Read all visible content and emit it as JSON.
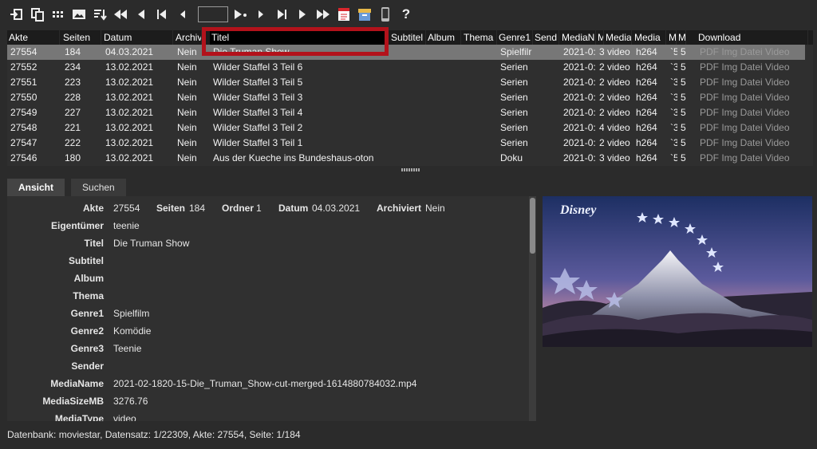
{
  "toolbar": {
    "icons": [
      "import-icon",
      "copy-icon",
      "grid-icon",
      "image-icon",
      "sort-icon",
      "first-page-icon",
      "prev-page-icon",
      "first-record-icon",
      "prev-record-icon",
      "record-input",
      "play-icon",
      "next-record-icon",
      "last-record-icon",
      "next-page-icon",
      "last-page-icon",
      "pdf-icon",
      "archive-icon",
      "phone-icon",
      "help-icon"
    ],
    "record_value": "",
    "help_label": "?"
  },
  "table": {
    "columns": [
      "Akte",
      "Seiten",
      "Datum",
      "Archiv",
      "Titel",
      "Subtitel",
      "Album",
      "Thema",
      "Genre1",
      "Send",
      "MediaN",
      "M",
      "Media",
      "Media",
      "M",
      "M",
      "Download"
    ],
    "rows": [
      {
        "akte": "27554",
        "seiten": "184",
        "datum": "04.03.2021",
        "archiv": "Nein",
        "titel": "Die Truman Show",
        "genre": "Spielfilr",
        "median": "2021-0:",
        "m": "3",
        "mtype": "video",
        "codec": "h264",
        "m1": "`5",
        "m2": "5",
        "download": "PDF Img Datei Video"
      },
      {
        "akte": "27552",
        "seiten": "234",
        "datum": "13.02.2021",
        "archiv": "Nein",
        "titel": "Wilder Staffel 3 Teil 6",
        "genre": "Serien",
        "median": "2021-0:",
        "m": "2",
        "mtype": "video",
        "codec": "h264",
        "m1": "`3",
        "m2": "5",
        "download": "PDF Img Datei Video"
      },
      {
        "akte": "27551",
        "seiten": "223",
        "datum": "13.02.2021",
        "archiv": "Nein",
        "titel": "Wilder Staffel 3 Teil 5",
        "genre": "Serien",
        "median": "2021-0:",
        "m": "2",
        "mtype": "video",
        "codec": "h264",
        "m1": "`3",
        "m2": "5",
        "download": "PDF Img Datei Video"
      },
      {
        "akte": "27550",
        "seiten": "228",
        "datum": "13.02.2021",
        "archiv": "Nein",
        "titel": "Wilder Staffel 3 Teil 3",
        "genre": "Serien",
        "median": "2021-0:",
        "m": "2",
        "mtype": "video",
        "codec": "h264",
        "m1": "`3",
        "m2": "5",
        "download": "PDF Img Datei Video"
      },
      {
        "akte": "27549",
        "seiten": "227",
        "datum": "13.02.2021",
        "archiv": "Nein",
        "titel": "Wilder Staffel 3 Teil 4",
        "genre": "Serien",
        "median": "2021-0:",
        "m": "2",
        "mtype": "video",
        "codec": "h264",
        "m1": "`3",
        "m2": "5",
        "download": "PDF Img Datei Video"
      },
      {
        "akte": "27548",
        "seiten": "221",
        "datum": "13.02.2021",
        "archiv": "Nein",
        "titel": "Wilder Staffel 3 Teil 2",
        "genre": "Serien",
        "median": "2021-0:",
        "m": "4",
        "mtype": "video",
        "codec": "h264",
        "m1": "`3",
        "m2": "5",
        "download": "PDF Img Datei Video"
      },
      {
        "akte": "27547",
        "seiten": "222",
        "datum": "13.02.2021",
        "archiv": "Nein",
        "titel": "Wilder Staffel 3 Teil 1",
        "genre": "Serien",
        "median": "2021-0:",
        "m": "2",
        "mtype": "video",
        "codec": "h264",
        "m1": "`3",
        "m2": "5",
        "download": "PDF Img Datei Video"
      },
      {
        "akte": "27546",
        "seiten": "180",
        "datum": "13.02.2021",
        "archiv": "Nein",
        "titel": "Aus der Kueche ins Bundeshaus-oton",
        "genre": "Doku",
        "median": "2021-0:",
        "m": "3",
        "mtype": "video",
        "codec": "h264",
        "m1": "`5",
        "m2": "5",
        "download": "PDF Img Datei Video"
      }
    ]
  },
  "tabs": [
    {
      "label": "Ansicht"
    },
    {
      "label": "Suchen"
    }
  ],
  "detail": {
    "top": {
      "akte_label": "Akte",
      "akte": "27554",
      "seiten_label": "Seiten",
      "seiten": "184",
      "ordner_label": "Ordner",
      "ordner": "1",
      "datum_label": "Datum",
      "datum": "04.03.2021",
      "archiviert_label": "Archiviert",
      "archiviert": "Nein"
    },
    "fields": [
      {
        "label": "Eigentümer",
        "value": "teenie"
      },
      {
        "label": "Titel",
        "value": "Die Truman Show"
      },
      {
        "label": "Subtitel",
        "value": ""
      },
      {
        "label": "Album",
        "value": ""
      },
      {
        "label": "Thema",
        "value": ""
      },
      {
        "label": "Genre1",
        "value": "Spielfilm"
      },
      {
        "label": "Genre2",
        "value": "Komödie"
      },
      {
        "label": "Genre3",
        "value": "Teenie"
      },
      {
        "label": "Sender",
        "value": ""
      },
      {
        "label": "MediaName",
        "value": "2021-02-1820-15-Die_Truman_Show-cut-merged-1614880784032.mp4"
      },
      {
        "label": "MediaSizeMB",
        "value": "3276.76"
      },
      {
        "label": "MediaType",
        "value": "video"
      }
    ]
  },
  "poster": {
    "logo_text": "Disney"
  },
  "status": "Datenbank: moviestar, Datensatz: 1/22309, Akte: 27554, Seite: 1/184",
  "colors": {
    "highlight": "#b3121b",
    "selected_row": "#777777"
  }
}
